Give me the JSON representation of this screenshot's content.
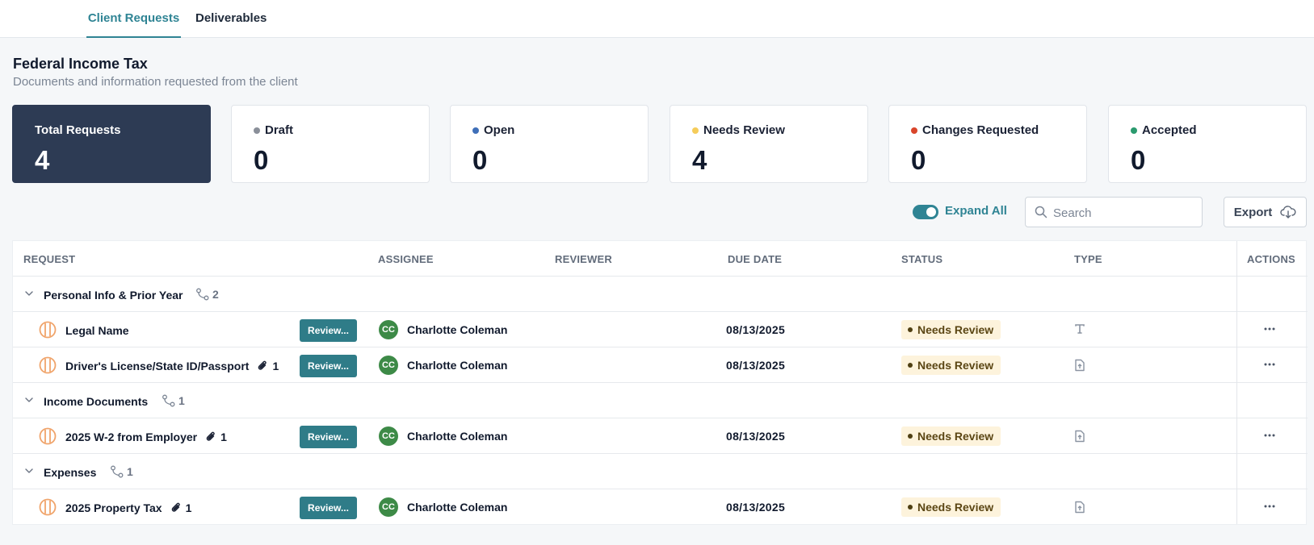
{
  "tabs": [
    {
      "label": "Client Requests",
      "active": true
    },
    {
      "label": "Deliverables",
      "active": false
    }
  ],
  "header": {
    "title": "Federal Income Tax",
    "subtitle": "Documents and information requested from the client"
  },
  "stats": [
    {
      "label": "Total Requests",
      "value": "4",
      "dot_color": ""
    },
    {
      "label": "Draft",
      "value": "0",
      "dot_color": "#8a8f99"
    },
    {
      "label": "Open",
      "value": "0",
      "dot_color": "#3f6fb8"
    },
    {
      "label": "Needs Review",
      "value": "4",
      "dot_color": "#f5cc5a"
    },
    {
      "label": "Changes Requested",
      "value": "0",
      "dot_color": "#d9452b"
    },
    {
      "label": "Accepted",
      "value": "0",
      "dot_color": "#2a9a6e"
    }
  ],
  "toolbar": {
    "expand_all_label": "Expand All",
    "expand_all_on": true,
    "search_placeholder": "Search",
    "export_label": "Export"
  },
  "table": {
    "columns": [
      "REQUEST",
      "ASSIGNEE",
      "REVIEWER",
      "DUE DATE",
      "STATUS",
      "TYPE",
      "ACTIONS"
    ],
    "groups": [
      {
        "name": "Personal Info & Prior Year",
        "count": "2",
        "items": [
          {
            "name": "Legal Name",
            "attachments": "",
            "review_label": "Review...",
            "assignee_initials": "CC",
            "assignee": "Charlotte Coleman",
            "reviewer": "",
            "due_date": "08/13/2025",
            "status": "Needs Review",
            "type_icon": "text-type-icon"
          },
          {
            "name": "Driver's License/State ID/Passport",
            "attachments": "1",
            "review_label": "Review...",
            "assignee_initials": "CC",
            "assignee": "Charlotte Coleman",
            "reviewer": "",
            "due_date": "08/13/2025",
            "status": "Needs Review",
            "type_icon": "file-upload-icon"
          }
        ]
      },
      {
        "name": "Income Documents",
        "count": "1",
        "items": [
          {
            "name": "2025 W-2 from Employer",
            "attachments": "1",
            "review_label": "Review...",
            "assignee_initials": "CC",
            "assignee": "Charlotte Coleman",
            "reviewer": "",
            "due_date": "08/13/2025",
            "status": "Needs Review",
            "type_icon": "file-upload-icon"
          }
        ]
      },
      {
        "name": "Expenses",
        "count": "1",
        "items": [
          {
            "name": "2025 Property Tax",
            "attachments": "1",
            "review_label": "Review...",
            "assignee_initials": "CC",
            "assignee": "Charlotte Coleman",
            "reviewer": "",
            "due_date": "08/13/2025",
            "status": "Needs Review",
            "type_icon": "file-upload-icon"
          }
        ]
      }
    ]
  },
  "colors": {
    "accent": "#2f8494",
    "review_button": "#2f7c88",
    "avatar": "#3d8a47",
    "total_card": "#2d3b54",
    "status_circle": "#f0a46b",
    "needs_review_badge": "#fdf3dc"
  }
}
